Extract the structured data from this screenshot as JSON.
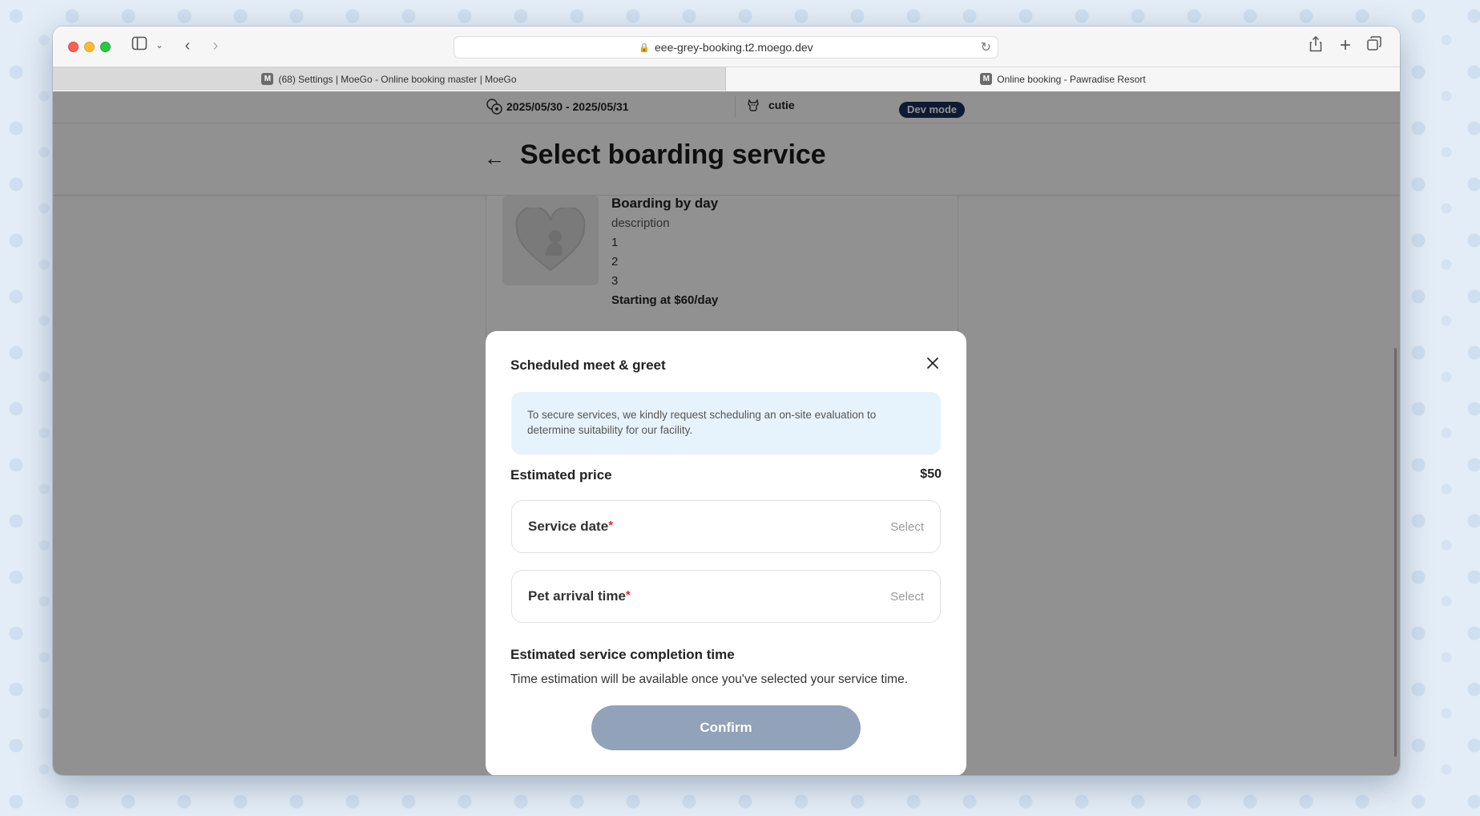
{
  "browser": {
    "url": "eee-grey-booking.t2.moego.dev",
    "tabs": [
      {
        "favicon": "M",
        "label": "(68) Settings | MoeGo - Online booking master | MoeGo"
      },
      {
        "favicon": "M",
        "label": "Online booking - Pawradise Resort"
      }
    ]
  },
  "booking_info": {
    "date_range": "2025/05/30 - 2025/05/31",
    "pet_name": "cutie",
    "dev_mode_label": "Dev mode"
  },
  "page": {
    "title": "Select boarding service"
  },
  "service": {
    "name": "Boarding by day",
    "description": "description",
    "lines": [
      "1",
      "2",
      "3"
    ],
    "price": "Starting at $60/day"
  },
  "modal": {
    "title": "Scheduled meet & greet",
    "notice": "To secure services, we kindly request scheduling an on-site evaluation to determine suitability for our facility.",
    "estimated_price_label": "Estimated price",
    "estimated_price_value": "$50",
    "fields": [
      {
        "label": "Service date",
        "required_mark": "*",
        "placeholder": "Select"
      },
      {
        "label": "Pet arrival time",
        "required_mark": "*",
        "placeholder": "Select"
      }
    ],
    "completion_title": "Estimated service completion time",
    "completion_text": "Time estimation will be available once you've selected your service time.",
    "confirm_label": "Confirm"
  },
  "colors": {
    "dev_mode_bg": "#1a2f5c",
    "confirm_disabled": "#91a2b9",
    "notice_bg": "#e6f3fd",
    "required": "#e02828"
  }
}
